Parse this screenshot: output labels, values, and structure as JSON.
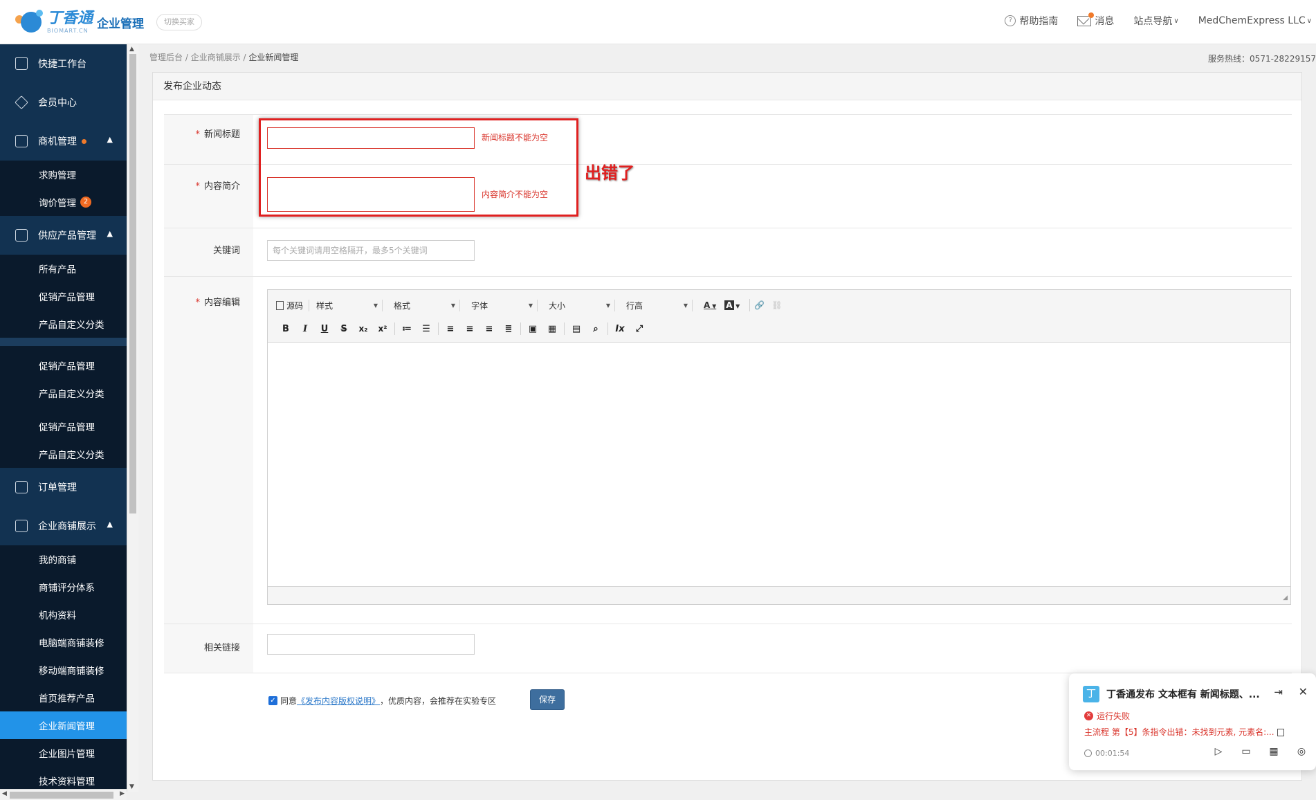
{
  "header": {
    "logo_cn": "丁香通",
    "logo_en": "BIOMART.CN",
    "app_title": "企业管理",
    "switch_label": "切换买家",
    "help_label": "帮助指南",
    "message_label": "消息",
    "site_nav_label": "站点导航",
    "account_label": "MedChemExpress LLC"
  },
  "sidebar": {
    "workbench": "快捷工作台",
    "member": "会员中心",
    "business": {
      "label": "商机管理",
      "items": [
        "求购管理",
        "询价管理"
      ],
      "inquiry_badge": "2"
    },
    "supply": {
      "label": "供应产品管理",
      "items": [
        "所有产品",
        "促销产品管理",
        "产品自定义分类",
        "促销产品管理",
        "产品自定义分类",
        "促销产品管理",
        "产品自定义分类"
      ]
    },
    "orders": "订单管理",
    "shop": {
      "label": "企业商铺展示",
      "items": [
        "我的商铺",
        "商铺评分体系",
        "机构资料",
        "电脑端商铺装修",
        "移动端商铺装修",
        "首页推荐产品",
        "企业新闻管理",
        "企业图片管理",
        "技术资料管理"
      ]
    }
  },
  "breadcrumb": {
    "root": "管理后台",
    "parent": "企业商铺展示",
    "current": "企业新闻管理",
    "sep": " / "
  },
  "hotline": "服务热线：0571-28229157",
  "form": {
    "panel_title": "发布企业动态",
    "required_mark": "*",
    "title_label": "新闻标题",
    "title_value": "",
    "title_error": "新闻标题不能为空",
    "summary_label": "内容简介",
    "summary_value": "",
    "summary_error": "内容简介不能为空",
    "keywords_label": "关键词",
    "keywords_placeholder": "每个关键词请用空格隔开，最多5个关键词",
    "content_label": "内容编辑",
    "link_label": "相关链接",
    "link_value": "",
    "agree_prefix": "同意",
    "agree_link": "《发布内容版权说明》",
    "agree_suffix": "，优质内容，会推荐在实验专区",
    "save_label": "保存"
  },
  "editor_toolbar": {
    "source": "源码",
    "style": "样式",
    "format": "格式",
    "font": "字体",
    "size": "大小",
    "line_height": "行高",
    "bold": "B",
    "italic": "I",
    "underline": "U",
    "strike": "S",
    "subscript": "x₂",
    "superscript": "x²",
    "text_color": "A",
    "bg_color": "A"
  },
  "annotation": {
    "text": "出错了",
    "color": "#e02020"
  },
  "notification": {
    "icon_char": "丁",
    "title": "丁香通发布 文本框有 新闻标题、...",
    "status": "运行失败",
    "error": "主流程  第【5】条指令出错：未找到元素, 元素名:...",
    "time": "00:01:54"
  },
  "colors": {
    "sidebar_bg": "#0d2239",
    "sidebar_active": "#2293e8",
    "error_red": "#d9342b",
    "save_button": "#3e6e9e"
  }
}
